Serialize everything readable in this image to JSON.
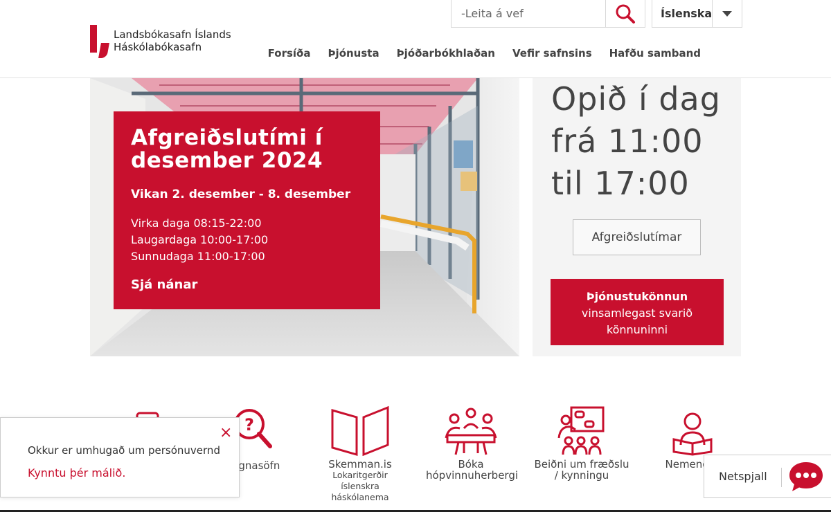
{
  "header": {
    "logo_line1": "Landsbókasafn Íslands",
    "logo_line2": "Háskólabókasafn",
    "search_placeholder": "-Leita á vef",
    "language": "Íslenska",
    "nav": [
      "Forsíða",
      "Þjónusta",
      "Þjóðarbókhlaðan",
      "Vefir safnsins",
      "Hafðu samband"
    ]
  },
  "hero": {
    "title": "Afgreiðslutími í desember 2024",
    "week": "Vikan 2. desember - 8. desember",
    "hours": [
      "Virka daga 08:15-22:00",
      "Laugardaga 10:00-17:00",
      "Sunnudaga 11:00-17:00"
    ],
    "more": "Sjá nánar"
  },
  "open_panel": {
    "text": "Opið í dag frá 11:00 til 17:00",
    "hours_button": "Afgreiðslutímar",
    "survey_title": "Þjónustukönnun",
    "survey_text": "vinsamlegast svarið könnuninni"
  },
  "services": [
    {
      "label": "gagnasöfn",
      "sub": "",
      "icon": "search-question-icon"
    },
    {
      "label": "Skemman.is",
      "sub": "Lokaritgerðir íslenskra háskólanema",
      "icon": "open-book-icon"
    },
    {
      "label": "Bóka hópvinnuherbergi",
      "sub": "",
      "icon": "group-table-icon"
    },
    {
      "label": "Beiðni um fræðslu / kynningu",
      "sub": "",
      "icon": "presentation-icon"
    },
    {
      "label": "Nemendur",
      "sub": "",
      "icon": "student-reading-icon"
    }
  ],
  "cookie": {
    "text": "Okkur er umhugað um persónuvernd",
    "link": "Kynntu þér málið.",
    "close": "×"
  },
  "chat": {
    "label": "Netspjall"
  },
  "colors": {
    "accent": "#c8102e"
  }
}
